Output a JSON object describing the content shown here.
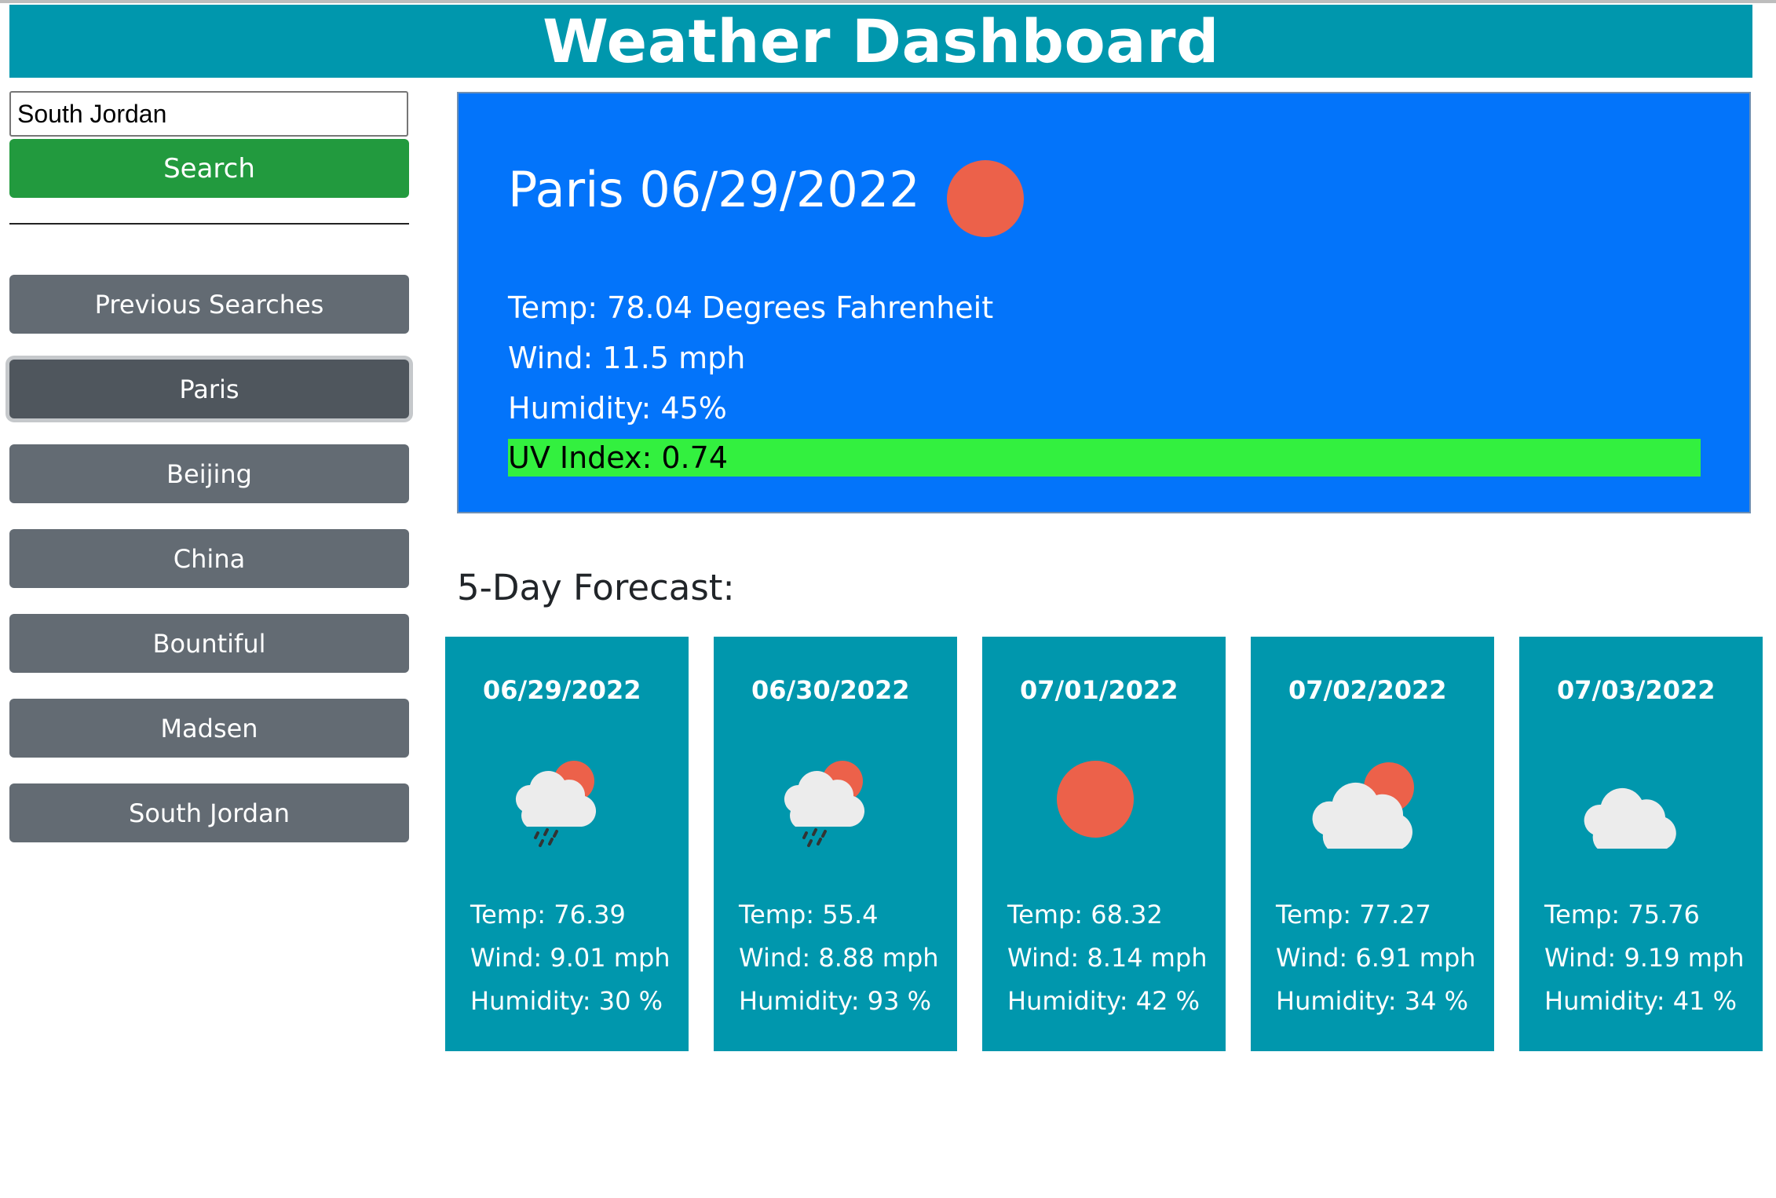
{
  "header": {
    "title": "Weather Dashboard"
  },
  "search": {
    "value": "South Jordan",
    "button_label": "Search"
  },
  "sidebar": {
    "history_label": "Previous Searches",
    "cities": [
      "Paris",
      "Beijing",
      "China",
      "Bountiful",
      "Madsen",
      "South Jordan"
    ],
    "active_city": "Paris"
  },
  "current": {
    "title": "Paris 06/29/2022",
    "icon": "sun-icon",
    "temp": "Temp: 78.04 Degrees Fahrenheit",
    "wind": "Wind: 11.5 mph",
    "humidity": "Humidity: 45%",
    "uv": "UV Index: 0.74",
    "uv_color": "#33f03f"
  },
  "forecast": {
    "title": "5-Day Forecast:",
    "days": [
      {
        "date": "06/29/2022",
        "icon": "rain-cloud-sun-icon",
        "temp": "Temp: 76.39",
        "wind": "Wind: 9.01 mph",
        "humidity": "Humidity: 30 %"
      },
      {
        "date": "06/30/2022",
        "icon": "rain-cloud-sun-icon",
        "temp": "Temp: 55.4",
        "wind": "Wind: 8.88 mph",
        "humidity": "Humidity: 93 %"
      },
      {
        "date": "07/01/2022",
        "icon": "sun-icon",
        "temp": "Temp: 68.32",
        "wind": "Wind: 8.14 mph",
        "humidity": "Humidity: 42 %"
      },
      {
        "date": "07/02/2022",
        "icon": "cloud-sun-icon",
        "temp": "Temp: 77.27",
        "wind": "Wind: 6.91 mph",
        "humidity": "Humidity: 34 %"
      },
      {
        "date": "07/03/2022",
        "icon": "cloud-icon",
        "temp": "Temp: 75.76",
        "wind": "Wind: 9.19 mph",
        "humidity": "Humidity: 41 %"
      }
    ]
  },
  "colors": {
    "header": "#0097ad",
    "current_bg": "#0374fa",
    "search_button": "#229a3e",
    "sidebar_button": "#636b73",
    "sun": "#ec614a"
  }
}
